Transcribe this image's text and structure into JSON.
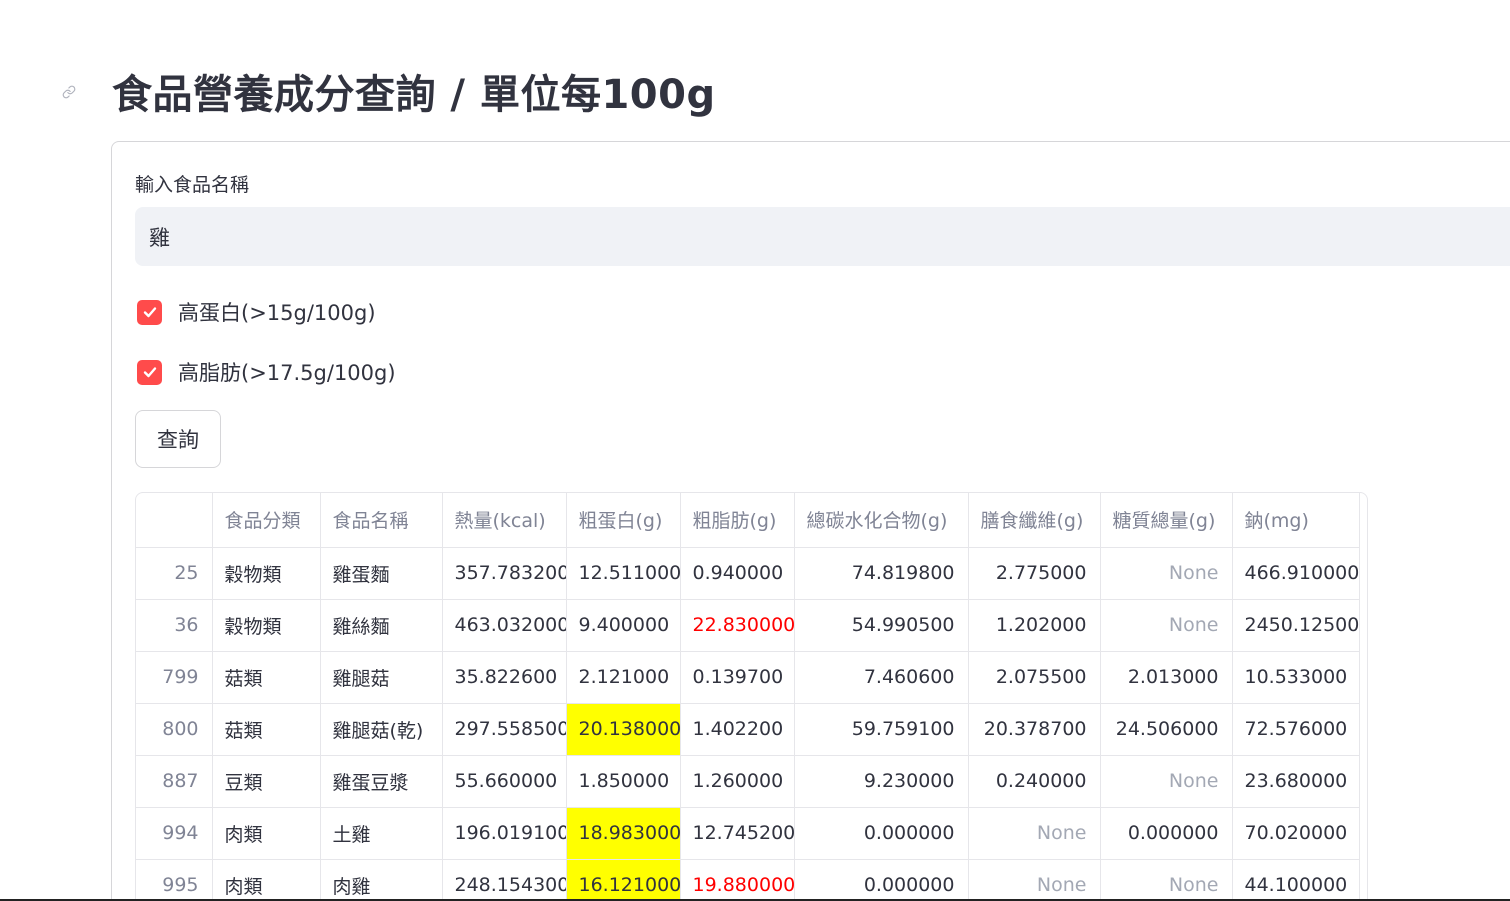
{
  "page": {
    "title": "食品營養成分查詢 / 單位每100g"
  },
  "form": {
    "input_label": "輸入食品名稱",
    "input_value": "雞",
    "checkbox_high_protein": {
      "label": "高蛋白(>15g/100g)",
      "checked": true
    },
    "checkbox_high_fat": {
      "label": "高脂肪(>17.5g/100g)",
      "checked": true
    },
    "query_button_label": "查詢",
    "accent_color": "#ff4b4b"
  },
  "table": {
    "columns": [
      "",
      "食品分類",
      "食品名稱",
      "熱量(kcal)",
      "粗蛋白(g)",
      "粗脂肪(g)",
      "總碳水化合物(g)",
      "膳食纖維(g)",
      "糖質總量(g)",
      "鈉(mg)"
    ],
    "rows": [
      {
        "index": "25",
        "category": "穀物類",
        "name": "雞蛋麵",
        "kcal": "357.783200",
        "protein": "12.511000",
        "fat": "0.940000",
        "carb": "74.819800",
        "fiber": "2.775000",
        "sugar": "None",
        "sodium": "466.910000"
      },
      {
        "index": "36",
        "category": "穀物類",
        "name": "雞絲麵",
        "kcal": "463.032000",
        "protein": "9.400000",
        "fat": "22.830000",
        "carb": "54.990500",
        "fiber": "1.202000",
        "sugar": "None",
        "sodium": "2450.125000"
      },
      {
        "index": "799",
        "category": "菇類",
        "name": "雞腿菇",
        "kcal": "35.822600",
        "protein": "2.121000",
        "fat": "0.139700",
        "carb": "7.460600",
        "fiber": "2.075500",
        "sugar": "2.013000",
        "sodium": "10.533000"
      },
      {
        "index": "800",
        "category": "菇類",
        "name": "雞腿菇(乾)",
        "kcal": "297.558500",
        "protein": "20.138000",
        "fat": "1.402200",
        "carb": "59.759100",
        "fiber": "20.378700",
        "sugar": "24.506000",
        "sodium": "72.576000"
      },
      {
        "index": "887",
        "category": "豆類",
        "name": "雞蛋豆漿",
        "kcal": "55.660000",
        "protein": "1.850000",
        "fat": "1.260000",
        "carb": "9.230000",
        "fiber": "0.240000",
        "sugar": "None",
        "sodium": "23.680000"
      },
      {
        "index": "994",
        "category": "肉類",
        "name": "土雞",
        "kcal": "196.019100",
        "protein": "18.983000",
        "fat": "12.745200",
        "carb": "0.000000",
        "fiber": "None",
        "sugar": "0.000000",
        "sodium": "70.020000"
      },
      {
        "index": "995",
        "category": "肉類",
        "name": "肉雞",
        "kcal": "248.154300",
        "protein": "16.121000",
        "fat": "19.880000",
        "carb": "0.000000",
        "fiber": "None",
        "sugar": "None",
        "sodium": "44.100000"
      }
    ],
    "highlight_protein_color": "#ffff00",
    "highlight_fat_color": "#ff0000"
  }
}
